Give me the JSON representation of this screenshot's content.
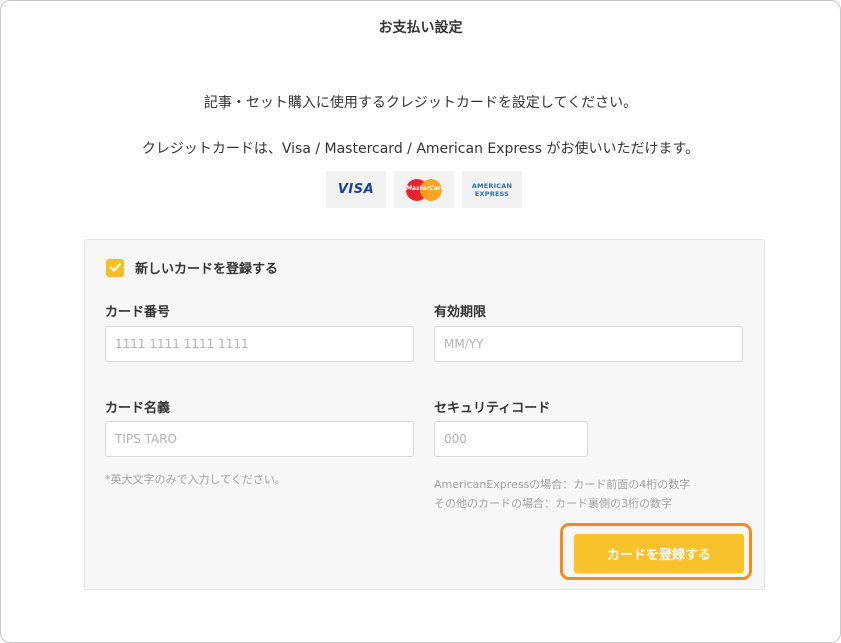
{
  "page": {
    "title": "お支払い設定",
    "description": "記事・セット購入に使用するクレジットカードを設定してください。",
    "cards_note": "クレジットカードは、Visa / Mastercard / American Express がお使いいただけます。"
  },
  "brands": {
    "visa": "VISA",
    "mastercard": "MasterCard",
    "amex_line1": "AMERICAN",
    "amex_line2": "EXPRESS"
  },
  "form": {
    "register_new_label": "新しいカードを登録する",
    "register_new_checked": true,
    "card_number": {
      "label": "カード番号",
      "placeholder": "1111 1111 1111 1111"
    },
    "expiry": {
      "label": "有効期限",
      "placeholder": "MM/YY"
    },
    "card_name": {
      "label": "カード名義",
      "placeholder": "TIPS TARO",
      "note": "*英大文字のみで入力してください。"
    },
    "security_code": {
      "label": "セキュリティコード",
      "placeholder": "000",
      "note_amex": "AmericanExpressの場合：カード前面の4桁の数字",
      "note_other": "その他のカードの場合：カード裏側の3桁の数字"
    },
    "submit_label": "カードを登録する"
  },
  "colors": {
    "accent": "#f8c22b",
    "highlight_border": "#f58a1f",
    "checkbox": "#f6bf26"
  }
}
